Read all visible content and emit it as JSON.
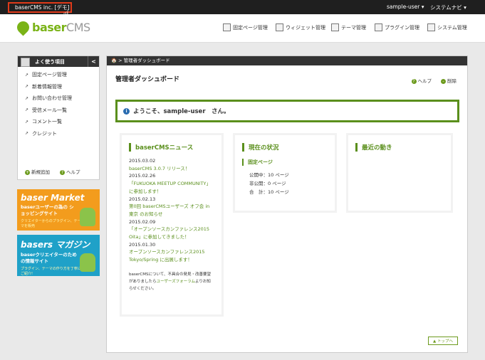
{
  "topbar": {
    "site_link": "baserCMS inc. [デモ]",
    "user_menu": "sample-user ▾",
    "system_nav": "システムナビ ▾"
  },
  "header": {
    "logo_text": "baser",
    "logo_suffix": "CMS",
    "nav": [
      {
        "label": "固定ページ管理",
        "icon": "page-icon"
      },
      {
        "label": "ウィジェット管理",
        "icon": "widget-icon"
      },
      {
        "label": "テーマ管理",
        "icon": "theme-icon"
      },
      {
        "label": "プラグイン管理",
        "icon": "plugin-icon"
      },
      {
        "label": "システム管理",
        "icon": "system-icon"
      }
    ]
  },
  "sidebar": {
    "title": "よく使う項目",
    "toggle": "<",
    "items": [
      {
        "label": "固定ページ管理"
      },
      {
        "label": "新着情報管理"
      },
      {
        "label": "お問い合わせ管理"
      },
      {
        "label": "受信メール一覧"
      },
      {
        "label": "コメント一覧"
      },
      {
        "label": "クレジット"
      }
    ],
    "add_label": "新規追加",
    "help_label": "ヘルプ"
  },
  "banners": {
    "market": {
      "title": "baser Market",
      "sub": "baserユーザーの為の ショッピングサイト",
      "small": "クリエイターからのプラグイン、テーマを販売"
    },
    "magazine": {
      "title": "basers マガジン",
      "sub": "baserクリエイターのための情報サイト",
      "small": "プラグイン、テーマの作り方を丁寧にご紹介!"
    }
  },
  "main": {
    "breadcrumb": "🏠 > 管理者ダッシュボード",
    "title": "管理者ダッシュボード",
    "help": "ヘルプ",
    "hide": "削除",
    "welcome": "ようこそ、sample-user　さん。",
    "news": {
      "title": "baserCMSニュース",
      "items": [
        {
          "date": "2015.03.02",
          "text": "baserCMS 3.0.7 リリース！"
        },
        {
          "date": "2015.02.26",
          "text": "「FUKUOKA MEETUP COMMUNITY」に参加します！"
        },
        {
          "date": "2015.02.13",
          "text": "第0回 baserCMSユーザーズ オフ会 in 東京 のお知らせ"
        },
        {
          "date": "2015.02.09",
          "text": "「オープンソースカンファレンス2015 Oita」に参加してきました！"
        },
        {
          "date": "2015.01.30",
          "text": "オープンソースカンファレンス2015 Tokyo/Spring に出展します！"
        }
      ],
      "foot_1": "baserCMSについて、不具合の発見・改善要望",
      "foot_2": "がありましたら",
      "foot_link": "ユーザーズフォーラム",
      "foot_3": "よりお知",
      "foot_4": "らせください。"
    },
    "status": {
      "title": "現在の状況",
      "sub": "固定ページ",
      "rows": [
        "公開中：10 ページ",
        "非公開：0 ページ",
        "合　計：10 ページ"
      ]
    },
    "recent": {
      "title": "最近の動き"
    },
    "totop": "▲ トップへ"
  }
}
